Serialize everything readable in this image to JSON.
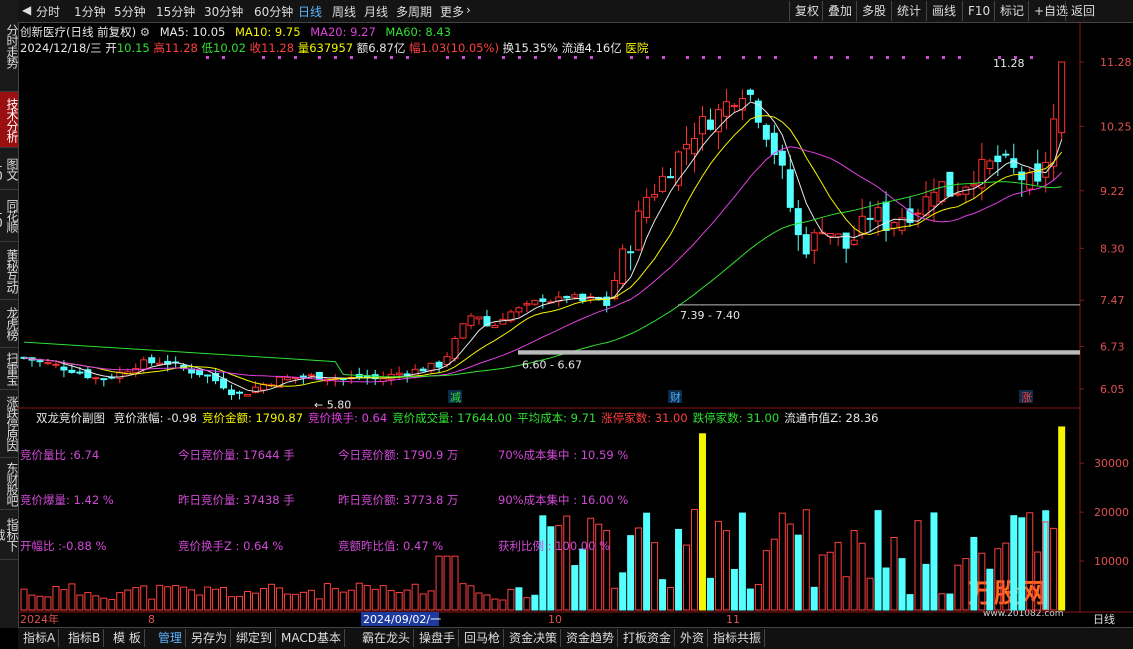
{
  "left_tabs": [
    {
      "label": "分时走势",
      "active": false
    },
    {
      "label": "技术分析",
      "active": true
    },
    {
      "label": "图文10",
      "active": false
    },
    {
      "label": "同花顺10",
      "active": false
    },
    {
      "label": "董秘互动",
      "active": false
    },
    {
      "label": "龙虎榜",
      "active": false
    },
    {
      "label": "扫雷宝",
      "active": false
    },
    {
      "label": "涨跌停原因",
      "active": false
    },
    {
      "label": "东财股吧",
      "active": false
    },
    {
      "label": "指标下载",
      "active": false
    }
  ],
  "toolbar": {
    "periods": [
      "分时",
      "1分钟",
      "5分钟",
      "15分钟",
      "30分钟",
      "60分钟",
      "日线",
      "周线",
      "月线",
      "多周期",
      "更多"
    ],
    "selected": "日线",
    "right": [
      "复权",
      "叠加",
      "多股",
      "统计",
      "画线",
      "F10",
      "标记",
      "+自选",
      "返回"
    ]
  },
  "header": {
    "stock": "创新医疗(日线 前复权)",
    "ma": [
      {
        "label": "MA5: 10.05",
        "color": "#e8e8e8"
      },
      {
        "label": "MA10: 9.75",
        "color": "#f5f500"
      },
      {
        "label": "MA20: 9.27",
        "color": "#e040e0"
      },
      {
        "label": "MA60: 8.43",
        "color": "#30e030"
      }
    ],
    "date": "2024/12/18/三",
    "open_l": "开",
    "open": "10.15",
    "high_l": "高",
    "high": "11.28",
    "low_l": "低",
    "low": "10.02",
    "close_l": "收",
    "close": "11.28",
    "vol_l": "量",
    "vol": "637957",
    "amt_l": "额",
    "amt": "6.87亿",
    "chg_l": "幅",
    "chg": "1.03(10.05%)",
    "turn_l": "换",
    "turn": "15.35%",
    "float_l": "流通",
    "float": "4.16亿",
    "sector": "医院"
  },
  "price_axis": [
    "11.28",
    "10.25",
    "9.22",
    "8.30",
    "7.47",
    "6.73",
    "6.05"
  ],
  "annotations": {
    "high_mark": "11.28",
    "low_mark": "5.80",
    "gap1": "7.39 - 7.40",
    "gap2": "6.60 - 6.67",
    "marker_jian": "减",
    "marker_cai": "财",
    "marker_zhang": "涨"
  },
  "sub": {
    "title": "双龙竞价副图",
    "items": [
      {
        "label": "竞价涨幅: -0.98",
        "color": "#e8e8e8"
      },
      {
        "label": "竞价金额: 1790.87",
        "color": "#f5f500"
      },
      {
        "label": "竞价换手: 0.64",
        "color": "#e040e0"
      },
      {
        "label": "竞价成交量: 17644.00",
        "color": "#30e030"
      },
      {
        "label": "平均成本: 9.71",
        "color": "#30e030"
      },
      {
        "label": "涨停家数: 31.00",
        "color": "#ff4040"
      },
      {
        "label": "跌停家数: 31.00",
        "color": "#30e030"
      },
      {
        "label": "流通市值Z: 28.36",
        "color": "#e8e8e8"
      }
    ],
    "stats": [
      "竞价量比 :6.74",
      "今日竞价量: 17644  手",
      "今日竞价额: 1790.9  万",
      "70%成本集中 :  10.59   %",
      "竞价爆量: 1.42  %",
      "昨日竞价量: 37438  手",
      "昨日竞价额: 3773.8  万",
      "90%成本集中 :  16.00   %",
      "开幅比   :-0.88  %",
      "竞价换手Z :  0.64   %",
      "竞额昨比值: 0.47  %",
      "获利比例      :  100.00   %"
    ],
    "vol_axis": [
      "30000",
      "20000",
      "10000"
    ]
  },
  "xaxis": {
    "labels": [
      "2024年",
      "8",
      "2024/09/02/一",
      "10",
      "11"
    ],
    "period": "日线"
  },
  "bottom_tabs": [
    "指标A",
    "指标B",
    "模 板",
    "管理",
    "另存为",
    "绑定到",
    "MACD基本",
    "霸在龙头",
    "操盘手",
    "回马枪",
    "资金决策",
    "资金趋势",
    "打板资金",
    "外资",
    "指标共振"
  ],
  "bottom_active": "管理",
  "watermark": "万股网",
  "watermark_url": "www.201082.com",
  "colors": {
    "up": "#ff3030",
    "down": "#54ffff",
    "ma5": "#e8e8e8",
    "ma10": "#f5f500",
    "ma20": "#e040e0",
    "ma60": "#30e030",
    "selected": "#5ab4ff"
  }
}
